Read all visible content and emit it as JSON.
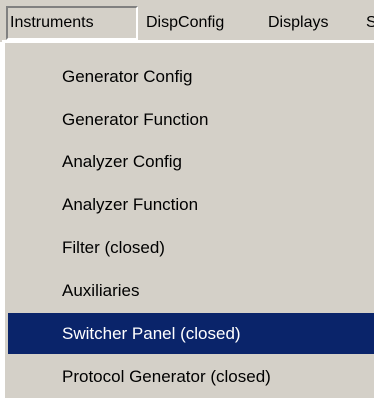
{
  "menubar": {
    "items": [
      {
        "label": "Instruments"
      },
      {
        "label": "DispConfig"
      },
      {
        "label": "Displays"
      },
      {
        "label": "S"
      }
    ]
  },
  "dropdown": {
    "items": [
      {
        "label": "Generator Config"
      },
      {
        "label": "Generator Function"
      },
      {
        "label": "Analyzer Config"
      },
      {
        "label": "Analyzer Function"
      },
      {
        "label": "Filter (closed)"
      },
      {
        "label": "Auxiliaries"
      },
      {
        "label": "Switcher Panel (closed)",
        "highlighted": true
      },
      {
        "label": "Protocol Generator (closed)"
      }
    ]
  },
  "colors": {
    "menu_background": "#d4d0c8",
    "highlight_background": "#0a246a",
    "highlight_text": "#ffffff"
  }
}
